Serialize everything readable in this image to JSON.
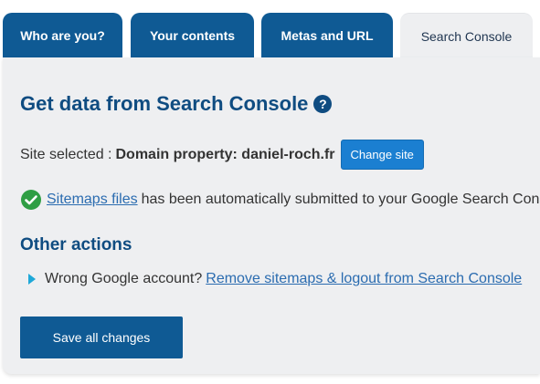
{
  "tabs": [
    {
      "label": "Who are you?",
      "active": false
    },
    {
      "label": "Your contents",
      "active": false
    },
    {
      "label": "Metas and URL",
      "active": false
    },
    {
      "label": "Search Console",
      "active": true
    }
  ],
  "section": {
    "title": "Get data from Search Console",
    "help_icon": "?",
    "site_selected_label": "Site selected :",
    "site_selected_value": "Domain property: daniel-roch.fr",
    "change_site_button": "Change site",
    "sitemaps_link": "Sitemaps files",
    "sitemaps_message": "has been automatically submitted to your Google Search Console"
  },
  "other_actions": {
    "title": "Other actions",
    "question": "Wrong Google account?",
    "logout_link": "Remove sitemaps & logout from Search Console"
  },
  "save_button": "Save all changes",
  "colors": {
    "primary": "#0f5a94",
    "title": "#0f4c81",
    "panel_bg": "#eeeff1",
    "link": "#2b6cb0",
    "check": "#2f9e44",
    "bullet": "#1ea8d8"
  },
  "icons": {
    "help": "question-circle-icon",
    "success": "check-circle-icon",
    "bullet": "triangle-right-icon"
  }
}
